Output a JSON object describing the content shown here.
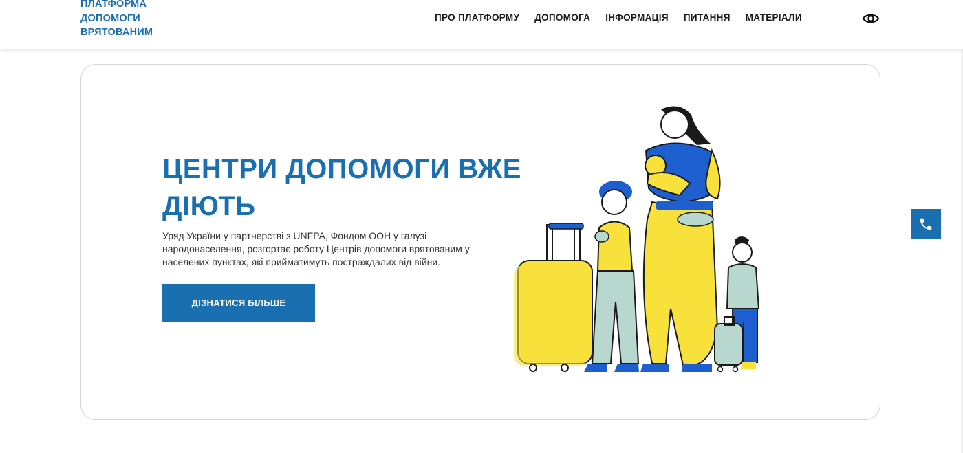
{
  "logo": {
    "line1": "ПЛАТФОРМА",
    "line2": "ДОПОМОГИ",
    "line3": "ВРЯТОВАНИМ"
  },
  "nav": {
    "items": [
      {
        "label": "ПРО ПЛАТФОРМУ"
      },
      {
        "label": "ДОПОМОГА"
      },
      {
        "label": "ІНФОРМАЦІЯ"
      },
      {
        "label": "ПИТАННЯ"
      },
      {
        "label": "МАТЕРІАЛИ"
      }
    ],
    "accessibility_icon": "eye-icon"
  },
  "hero": {
    "title": "ЦЕНТРИ ДОПОМОГИ ВЖЕ ДІЮТЬ",
    "text": "Уряд України у партнерстві з UNFPA, Фондом ООН у галузі народонаселення, розгортає роботу Центрів допомоги врятованим у населених пунктах, які прийматимуть постраждалих від війни.",
    "cta_label": "ДІЗНАТИСЯ БІЛЬШЕ",
    "illustration": "family-with-luggage-illustration"
  },
  "phone_button": {
    "icon": "phone-icon"
  },
  "colors": {
    "brand": "#1a6fb0",
    "yellow": "#f7e13a",
    "mint": "#b7d7cf",
    "blue": "#1e5fd0"
  }
}
